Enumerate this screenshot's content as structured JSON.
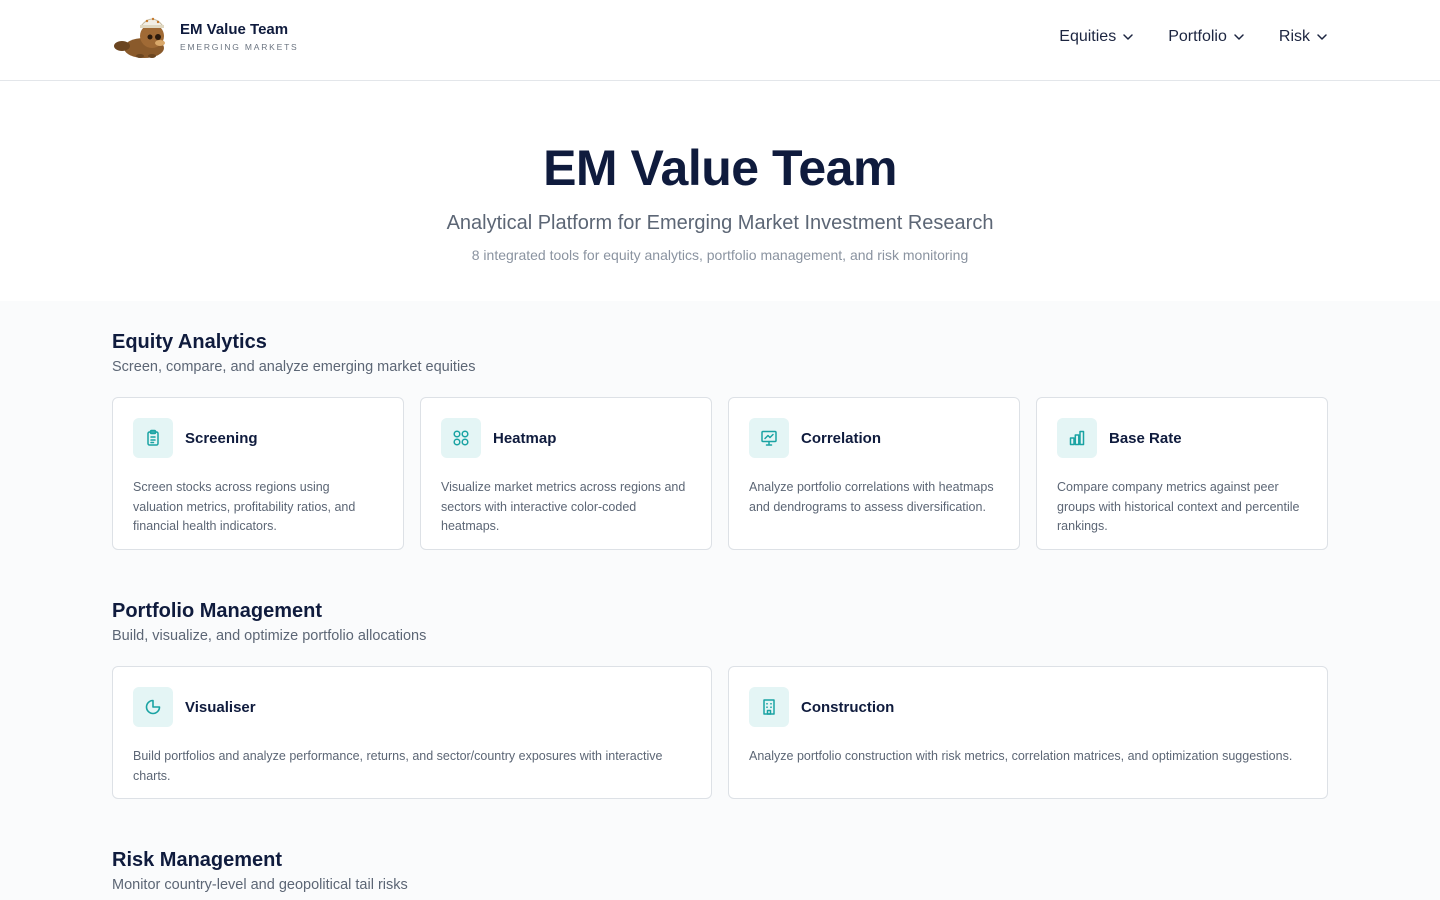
{
  "brand": {
    "name": "EM Value Team",
    "tagline": "EMERGING MARKETS"
  },
  "nav": {
    "items": [
      {
        "label": "Equities"
      },
      {
        "label": "Portfolio"
      },
      {
        "label": "Risk"
      }
    ]
  },
  "hero": {
    "title": "EM Value Team",
    "subtitle": "Analytical Platform for Emerging Market Investment Research",
    "note": "8 integrated tools for equity analytics, portfolio management, and risk monitoring"
  },
  "sections": [
    {
      "title": "Equity Analytics",
      "description": "Screen, compare, and analyze emerging market equities",
      "cards": [
        {
          "title": "Screening",
          "icon": "clipboard-icon",
          "description": "Screen stocks across regions using valuation metrics, profitability ratios, and financial health indicators."
        },
        {
          "title": "Heatmap",
          "icon": "grid-icon",
          "description": "Visualize market metrics across regions and sectors with interactive color-coded heatmaps."
        },
        {
          "title": "Correlation",
          "icon": "presentation-chart-icon",
          "description": "Analyze portfolio correlations with heatmaps and dendrograms to assess diversification."
        },
        {
          "title": "Base Rate",
          "icon": "bar-chart-icon",
          "description": "Compare company metrics against peer groups with historical context and percentile rankings."
        }
      ]
    },
    {
      "title": "Portfolio Management",
      "description": "Build, visualize, and optimize portfolio allocations",
      "cards": [
        {
          "title": "Visualiser",
          "icon": "pie-chart-icon",
          "description": "Build portfolios and analyze performance, returns, and sector/country exposures with interactive charts."
        },
        {
          "title": "Construction",
          "icon": "building-icon",
          "description": "Analyze portfolio construction with risk metrics, correlation matrices, and optimization suggestions."
        }
      ]
    },
    {
      "title": "Risk Management",
      "description": "Monitor country-level and geopolitical tail risks"
    }
  ],
  "colors": {
    "accent": "#1aa3a3",
    "icon_bg": "#e4f5f5",
    "heading": "#0f1b3d"
  }
}
